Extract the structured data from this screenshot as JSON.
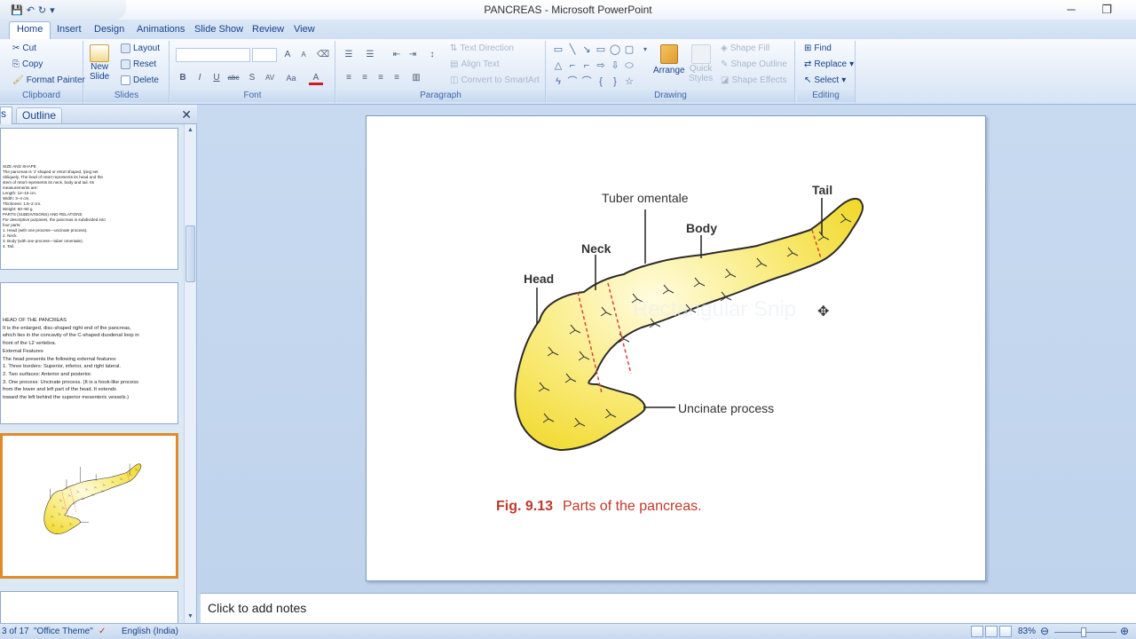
{
  "window": {
    "title": "PANCREAS - Microsoft PowerPoint",
    "minimize": "─",
    "restore": "❐"
  },
  "quick_access": {
    "save": "💾",
    "undo": "↶",
    "redo": "↻",
    "more": "▾"
  },
  "tabs": [
    "Home",
    "Insert",
    "Design",
    "Animations",
    "Slide Show",
    "Review",
    "View"
  ],
  "ribbon": {
    "clipboard": {
      "label": "Clipboard",
      "cut": "Cut",
      "copy": "Copy",
      "format_painter": "Format Painter"
    },
    "slides": {
      "label": "Slides",
      "new_slide": "New",
      "new_slide_2": "Slide",
      "layout": "Layout",
      "reset": "Reset",
      "delete": "Delete"
    },
    "font": {
      "label": "Font",
      "bold": "B",
      "italic": "I",
      "underline": "U",
      "strike": "abc",
      "shadow": "S",
      "spacing": "AV",
      "case": "Aa",
      "color": "A",
      "grow": "A",
      "shrink": "A",
      "clear": "⌫"
    },
    "paragraph": {
      "label": "Paragraph",
      "text_direction": "Text Direction",
      "align_text": "Align Text",
      "convert_smartart": "Convert to SmartArt"
    },
    "drawing": {
      "label": "Drawing",
      "arrange": "Arrange",
      "quick_styles": "Quick",
      "quick_styles_2": "Styles",
      "shape_fill": "Shape Fill",
      "shape_outline": "Shape Outline",
      "shape_effects": "Shape Effects"
    },
    "editing": {
      "label": "Editing",
      "find": "Find",
      "replace": "Replace",
      "select": "Select"
    }
  },
  "left_pane": {
    "slides_tab": "s",
    "outline_tab": "Outline",
    "close": "✕",
    "thumb1_text": "SIZE AND SHAPE\nThe pancreas is 'J' shaped or retort shaped, lying set\nobliquely. The bowl of retort represents its head and the\nstem of retort represents its neck, body and tail. Its\nmeasurements are:\nLength: 12–15 cm.\nWidth: 3–4 cm.\nThickness: 1.5–2 cm.\nWeight: 80–90 g.\nPARTS (SUBDIVISIONS) AND RELATIONS\nFor descriptive purposes, the pancreas is subdivided into\nfour parts:\n1. Head (with one process—uncinate process).\n2. Neck.\n3. Body (with one process—tuber omentale).\n4. Tail.",
    "thumb2_text": "HEAD OF THE PANCREAS\nIt is the enlarged, disc-shaped right end of the pancreas,\nwhich lies in the concavity of the C-shaped duodenal loop in\nfront of the L2 vertebra.\nExternal Features\nThe head presents the following external features:\n1. Three borders: Superior, inferior, and right lateral.\n2. Two surfaces: Anterior and posterior.\n3. One process: Uncinate process. (It is a hook-like process\nfrom the lower and left part of the head. It extends\ntoward the left behind the superior mesenteric vessels.)"
  },
  "slide": {
    "labels": {
      "tuber": "Tuber omentale",
      "tail": "Tail",
      "body": "Body",
      "neck": "Neck",
      "head": "Head",
      "uncinate": "Uncinate process"
    },
    "caption_num": "Fig. 9.13",
    "caption_text": "Parts of the pancreas.",
    "ghost_text": "Rectangular Snip"
  },
  "notes": {
    "placeholder": "Click to add notes"
  },
  "status": {
    "slide_count": "3 of 17",
    "theme": "\"Office Theme\"",
    "language": "English (India)",
    "zoom": "83%"
  },
  "colors": {
    "pancreas_fill": "#f7e34a",
    "caption": "#c0392b",
    "accent_border": "#e08a2a"
  }
}
